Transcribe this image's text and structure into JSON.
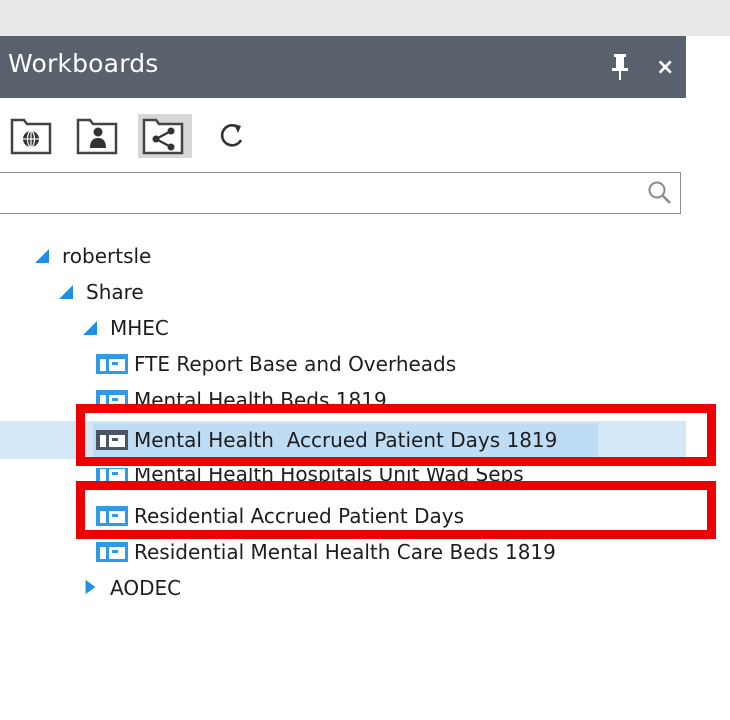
{
  "panel": {
    "title": "Workboards",
    "close_glyph": "×",
    "icons": {
      "pin": "pin-icon",
      "close": "close-icon"
    }
  },
  "toolbar": {
    "buttons": [
      {
        "name": "globe-folder-button",
        "icon": "globe-icon",
        "active": false
      },
      {
        "name": "user-folder-button",
        "icon": "user-icon",
        "active": false
      },
      {
        "name": "share-folder-button",
        "icon": "share-icon",
        "active": true
      },
      {
        "name": "refresh-button",
        "icon": "refresh-icon",
        "active": false
      }
    ]
  },
  "search": {
    "placeholder": "",
    "value": ""
  },
  "tree": {
    "items": [
      {
        "label": "robertsle",
        "type": "folder",
        "state": "expanded",
        "level": 0
      },
      {
        "label": "Share",
        "type": "folder",
        "state": "expanded",
        "level": 1
      },
      {
        "label": "MHEC",
        "type": "folder",
        "state": "expanded",
        "level": 2
      },
      {
        "label": "FTE Report Base and Overheads",
        "type": "workboard",
        "level": 3,
        "selected": false
      },
      {
        "label": "Mental Health Beds 1819",
        "type": "workboard",
        "level": 3,
        "selected": false
      },
      {
        "label": "Mental Health  Accrued Patient Days 1819",
        "type": "workboard",
        "level": 3,
        "selected": true,
        "highlighted": true
      },
      {
        "label": "Mental Health Hospitals Unit Wad Seps",
        "type": "workboard",
        "level": 3,
        "selected": false
      },
      {
        "label": "Residential Accrued Patient Days",
        "type": "workboard",
        "level": 3,
        "selected": false,
        "highlighted": true
      },
      {
        "label": "Residential Mental Health Care Beds 1819",
        "type": "workboard",
        "level": 3,
        "selected": false
      },
      {
        "label": "AODEC",
        "type": "folder",
        "state": "collapsed",
        "level": 2
      }
    ]
  },
  "colors": {
    "header_bg": "#59616d",
    "selection_bg": "#d5e8f7",
    "selection_text_bg": "#bedcf3",
    "annotation_red": "#ec0000",
    "expand_arrow": "#1f8fe6",
    "sheet_icon_blue": "#2f9ae8"
  }
}
